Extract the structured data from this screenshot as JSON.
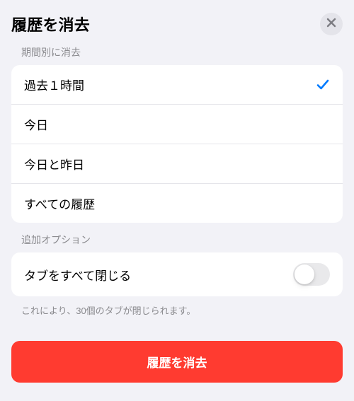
{
  "header": {
    "title": "履歴を消去"
  },
  "sections": {
    "timeframe": {
      "label": "期間別に消去",
      "options": [
        {
          "label": "過去１時間",
          "selected": true
        },
        {
          "label": "今日",
          "selected": false
        },
        {
          "label": "今日と昨日",
          "selected": false
        },
        {
          "label": "すべての履歴",
          "selected": false
        }
      ]
    },
    "additional": {
      "label": "追加オプション",
      "close_tabs": {
        "label": "タブをすべて閉じる",
        "enabled": false
      },
      "footnote": "これにより、30個のタブが閉じられます。"
    }
  },
  "action": {
    "clear_label": "履歴を消去"
  }
}
